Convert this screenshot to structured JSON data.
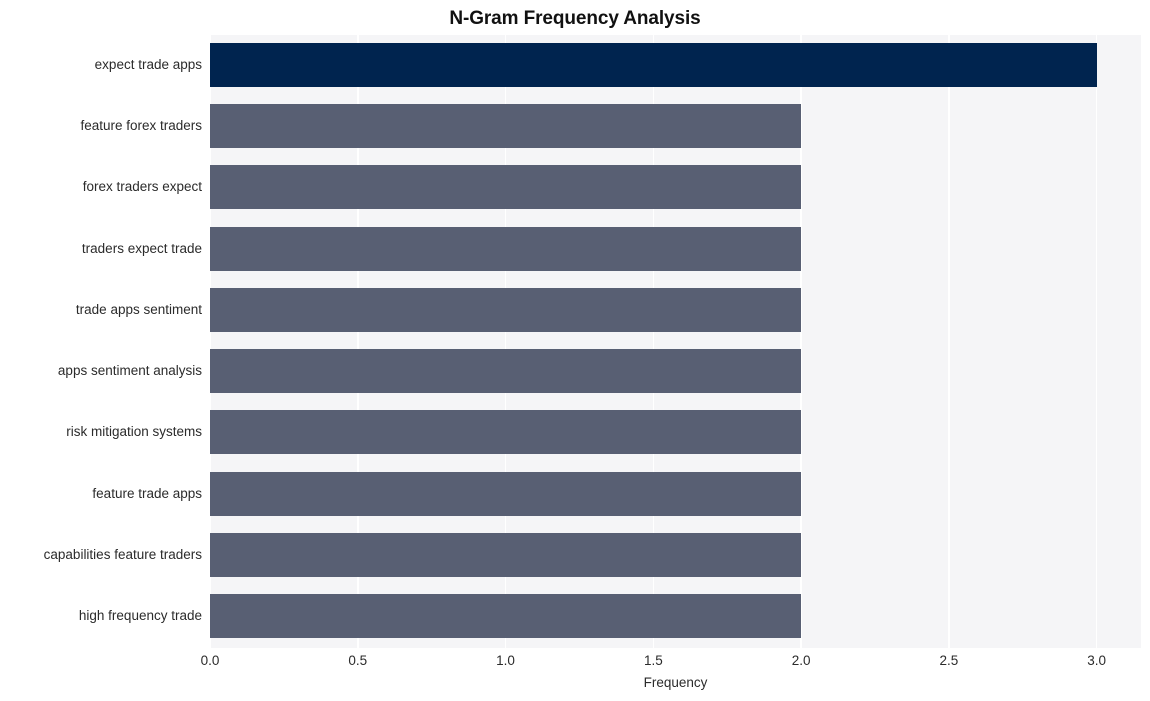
{
  "chart_data": {
    "type": "bar",
    "orientation": "horizontal",
    "title": "N-Gram Frequency Analysis",
    "xlabel": "Frequency",
    "ylabel": "",
    "categories": [
      "expect trade apps",
      "feature forex traders",
      "forex traders expect",
      "traders expect trade",
      "trade apps sentiment",
      "apps sentiment analysis",
      "risk mitigation systems",
      "feature trade apps",
      "capabilities feature traders",
      "high frequency trade"
    ],
    "values": [
      3,
      2,
      2,
      2,
      2,
      2,
      2,
      2,
      2,
      2
    ],
    "xlim": [
      0,
      3.15
    ],
    "xticks": [
      "0.0",
      "0.5",
      "1.0",
      "1.5",
      "2.0",
      "2.5",
      "3.0"
    ],
    "xtick_values": [
      0,
      0.5,
      1,
      1.5,
      2,
      2.5,
      3
    ],
    "grid": "vertical-only",
    "legend": "none",
    "bar_colors": [
      "#00244f",
      "#585f73",
      "#585f73",
      "#585f73",
      "#585f73",
      "#585f73",
      "#585f73",
      "#585f73",
      "#585f73",
      "#585f73"
    ],
    "plot_background": "#f5f5f7",
    "gridline_color": "#ffffff",
    "highlight_color": "#00244f",
    "bar_color": "#585f73"
  }
}
